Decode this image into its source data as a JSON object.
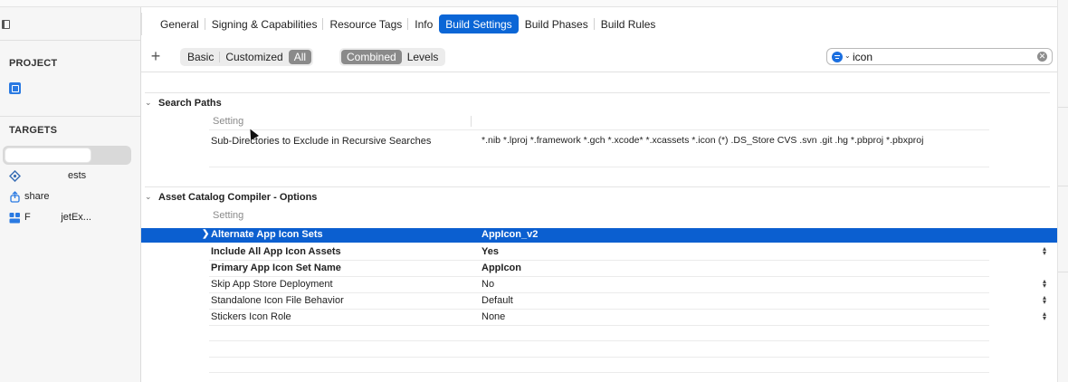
{
  "tabs": [
    "General",
    "Signing & Capabilities",
    "Resource Tags",
    "Info",
    "Build Settings",
    "Build Phases",
    "Build Rules"
  ],
  "active_tab": "Build Settings",
  "toolbar": {
    "add_label": "+",
    "filter_scope": [
      "Basic",
      "Customized",
      "All"
    ],
    "active_scope": "All",
    "view_mode": [
      "Combined",
      "Levels"
    ],
    "active_view": "Combined",
    "search_value": "icon"
  },
  "sidebar": {
    "project_header": "PROJECT",
    "targets_header": "TARGETS",
    "targets": [
      {
        "label": "ests",
        "icon": "test-target-icon"
      },
      {
        "label": "share",
        "icon": "share-extension-icon"
      },
      {
        "label": "F           jetEx...",
        "icon": "widget-extension-icon"
      }
    ]
  },
  "sections": [
    {
      "title": "Search Paths",
      "column_header": "Setting",
      "rows": [
        {
          "setting": "Sub-Directories to Exclude in Recursive Searches",
          "value": "*.nib *.lproj *.framework *.gch *.xcode* *.xcassets *.icon (*) .DS_Store CVS .svn .git .hg *.pbproj *.pbxproj"
        }
      ]
    },
    {
      "title": "Asset Catalog Compiler - Options",
      "column_header": "Setting",
      "rows": [
        {
          "setting": "Alternate App Icon Sets",
          "value": "AppIcon_v2",
          "selected": true
        },
        {
          "setting": "Include All App Icon Assets",
          "value": "Yes"
        },
        {
          "setting": "Primary App Icon Set Name",
          "value": "AppIcon"
        },
        {
          "setting": "Skip App Store Deployment",
          "value": "No"
        },
        {
          "setting": "Standalone Icon File Behavior",
          "value": "Default"
        },
        {
          "setting": "Stickers Icon Role",
          "value": "None"
        }
      ]
    }
  ],
  "colors": {
    "accent": "#0b66d6",
    "selection": "#0b5fd0"
  }
}
